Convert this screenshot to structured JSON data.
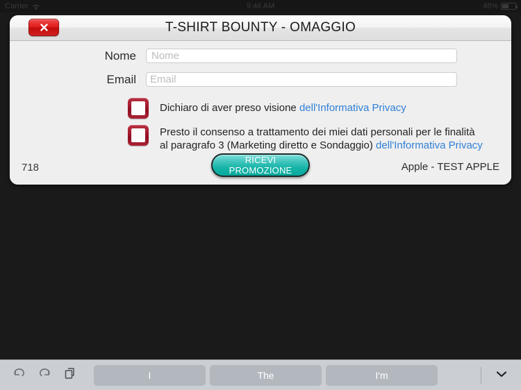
{
  "status_bar": {
    "carrier": "Carrier",
    "wifi_icon": "wifi-icon",
    "time": "9:46 AM",
    "battery_percent": "48%",
    "battery_icon": "battery-icon"
  },
  "dialog": {
    "title": "T-SHIRT BOUNTY - OMAGGIO",
    "close_icon": "close-x-icon",
    "form": {
      "name_label": "Nome",
      "name_placeholder": "Nome",
      "name_value": "",
      "email_label": "Email",
      "email_placeholder": "Email",
      "email_value": ""
    },
    "consents": [
      {
        "checked": false,
        "text": "Dichiaro di aver preso visione",
        "link": "dell'Informativa Privacy"
      },
      {
        "checked": false,
        "text_line1": "Presto il consenso a trattamento dei miei dati personali per le finalità",
        "text_line2": "al paragrafo 3 (Marketing diretto e Sondaggio)",
        "link": "dell'Informativa Privacy"
      }
    ],
    "footer": {
      "counter": "718",
      "submit_label": "RICEVI PROMOZIONE",
      "account": "Apple - TEST APPLE"
    }
  },
  "keyboard_toolbar": {
    "undo_icon": "undo-icon",
    "redo_icon": "redo-icon",
    "paste_icon": "paste-icon",
    "suggestions": [
      "I",
      "The",
      "I'm"
    ],
    "hide_keyboard_icon": "chevron-down-icon"
  },
  "colors": {
    "accent_teal": "#14b3a7",
    "link_blue": "#2f7fd6",
    "checkbox_red": "#a3182b",
    "close_red": "#e01f1f",
    "toolbar_gray": "#cbced3",
    "backdrop": "#1a1a1a"
  }
}
